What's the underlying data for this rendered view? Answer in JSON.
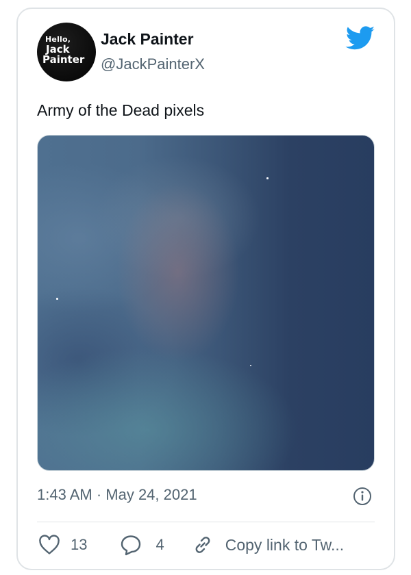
{
  "author": {
    "avatar_text": {
      "line1": "Hello,",
      "line2": "Jack",
      "line3": "Painter"
    },
    "name": "Jack Painter",
    "handle": "@JackPainterX"
  },
  "brand": {
    "icon": "twitter-bird-icon",
    "color": "#1d9bf0"
  },
  "tweet": {
    "text": "Army of the Dead pixels",
    "media_alt": "blurry night-sky photo with dead pixels",
    "timestamp": "1:43 AM · May 24, 2021"
  },
  "actions": {
    "like_count": "13",
    "reply_count": "4",
    "copy_link_label": "Copy link to Tw..."
  },
  "colors": {
    "text_primary": "#0f1419",
    "text_secondary": "#536471",
    "border": "#dfe3e6"
  }
}
